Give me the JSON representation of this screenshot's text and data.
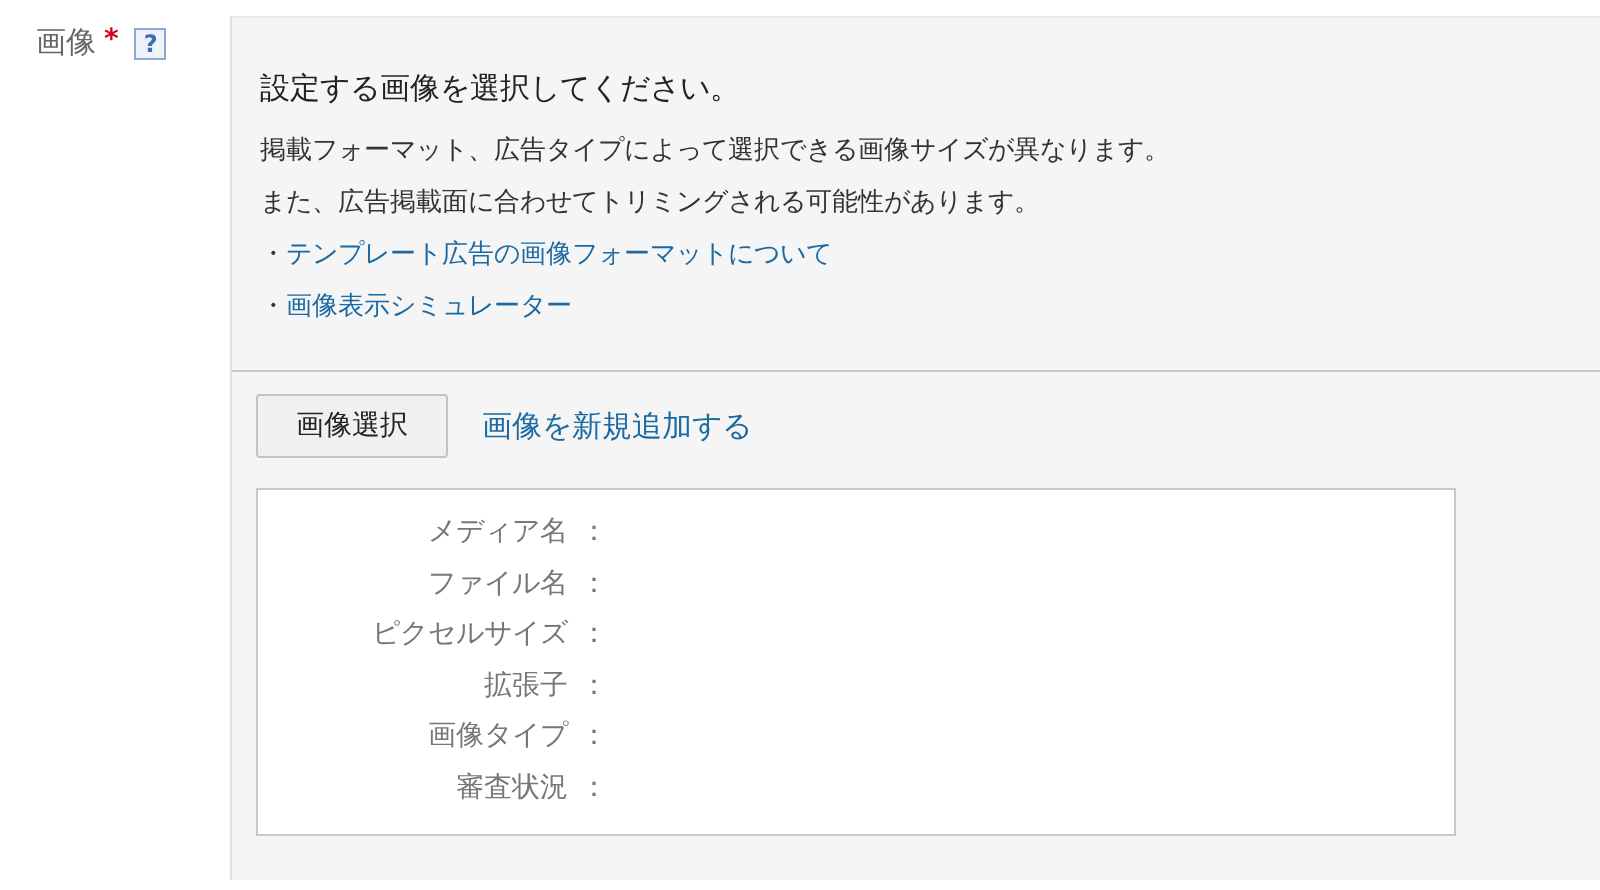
{
  "field": {
    "label": "画像",
    "required_mark": "*",
    "help": "?"
  },
  "panel": {
    "title": "設定する画像を選択してください。",
    "notes": [
      "掲載フォーマット、広告タイプによって選択できる画像サイズが異なります。",
      "また、広告掲載面に合わせてトリミングされる可能性があります。"
    ],
    "links": [
      {
        "bullet": "・",
        "text": "テンプレート広告の画像フォーマットについて"
      },
      {
        "bullet": "・",
        "text": "画像表示シミュレーター"
      }
    ],
    "select_button": "画像選択",
    "add_link": "画像を新規追加する",
    "details": [
      {
        "label": "メディア名",
        "sep": "："
      },
      {
        "label": "ファイル名",
        "sep": "："
      },
      {
        "label": "ピクセルサイズ",
        "sep": "："
      },
      {
        "label": "拡張子",
        "sep": "："
      },
      {
        "label": "画像タイプ",
        "sep": "："
      },
      {
        "label": "審査状況",
        "sep": "："
      }
    ]
  }
}
